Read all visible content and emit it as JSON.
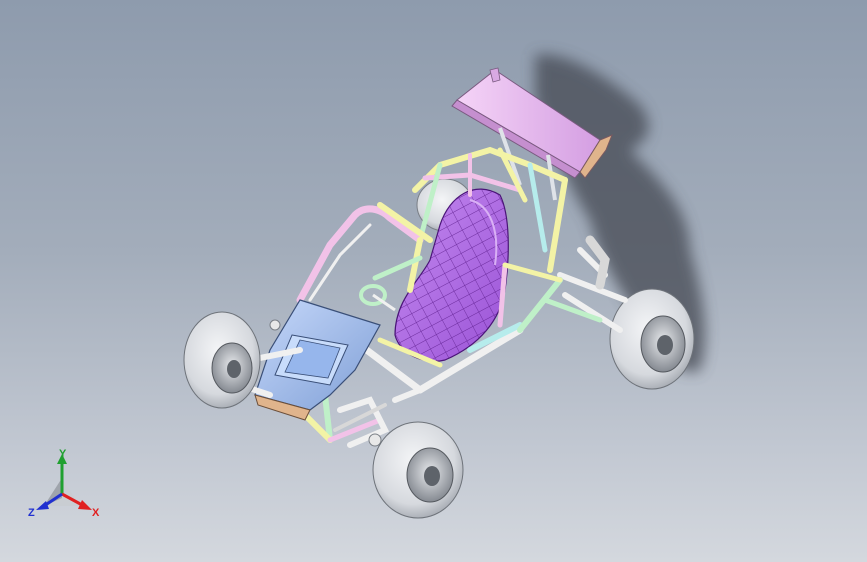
{
  "viewport": {
    "background_top": "#8e9bad",
    "background_bottom": "#d4d8de"
  },
  "model": {
    "name": "buggy-assembly",
    "parts": [
      "tube-frame",
      "roll-cage",
      "seat",
      "rear-wing",
      "front-hood",
      "front-left-wheel",
      "front-right-wheel",
      "rear-left-wheel",
      "rear-right-wheel",
      "steering-wheel",
      "front-suspension",
      "rear-suspension"
    ],
    "colors": {
      "frame_white": "#f2f2f2",
      "frame_yellow": "#f3f3a6",
      "frame_pink": "#f2c2e8",
      "frame_green": "#bff0c8",
      "frame_cyan": "#b6ecec",
      "seat": "#b06fe0",
      "seat_mesh": "#5a1a8a",
      "wing": "#e9bdf0",
      "wing_end": "#e0b48c",
      "hood": "#a9c4f2",
      "tire": "#e4e6ea",
      "rim": "#c3c7cd",
      "shadow": "#454a52"
    }
  },
  "triad": {
    "x_label": "X",
    "y_label": "Y",
    "z_label": "Z",
    "x_color": "#e02020",
    "y_color": "#20a030",
    "z_color": "#2030d0"
  }
}
